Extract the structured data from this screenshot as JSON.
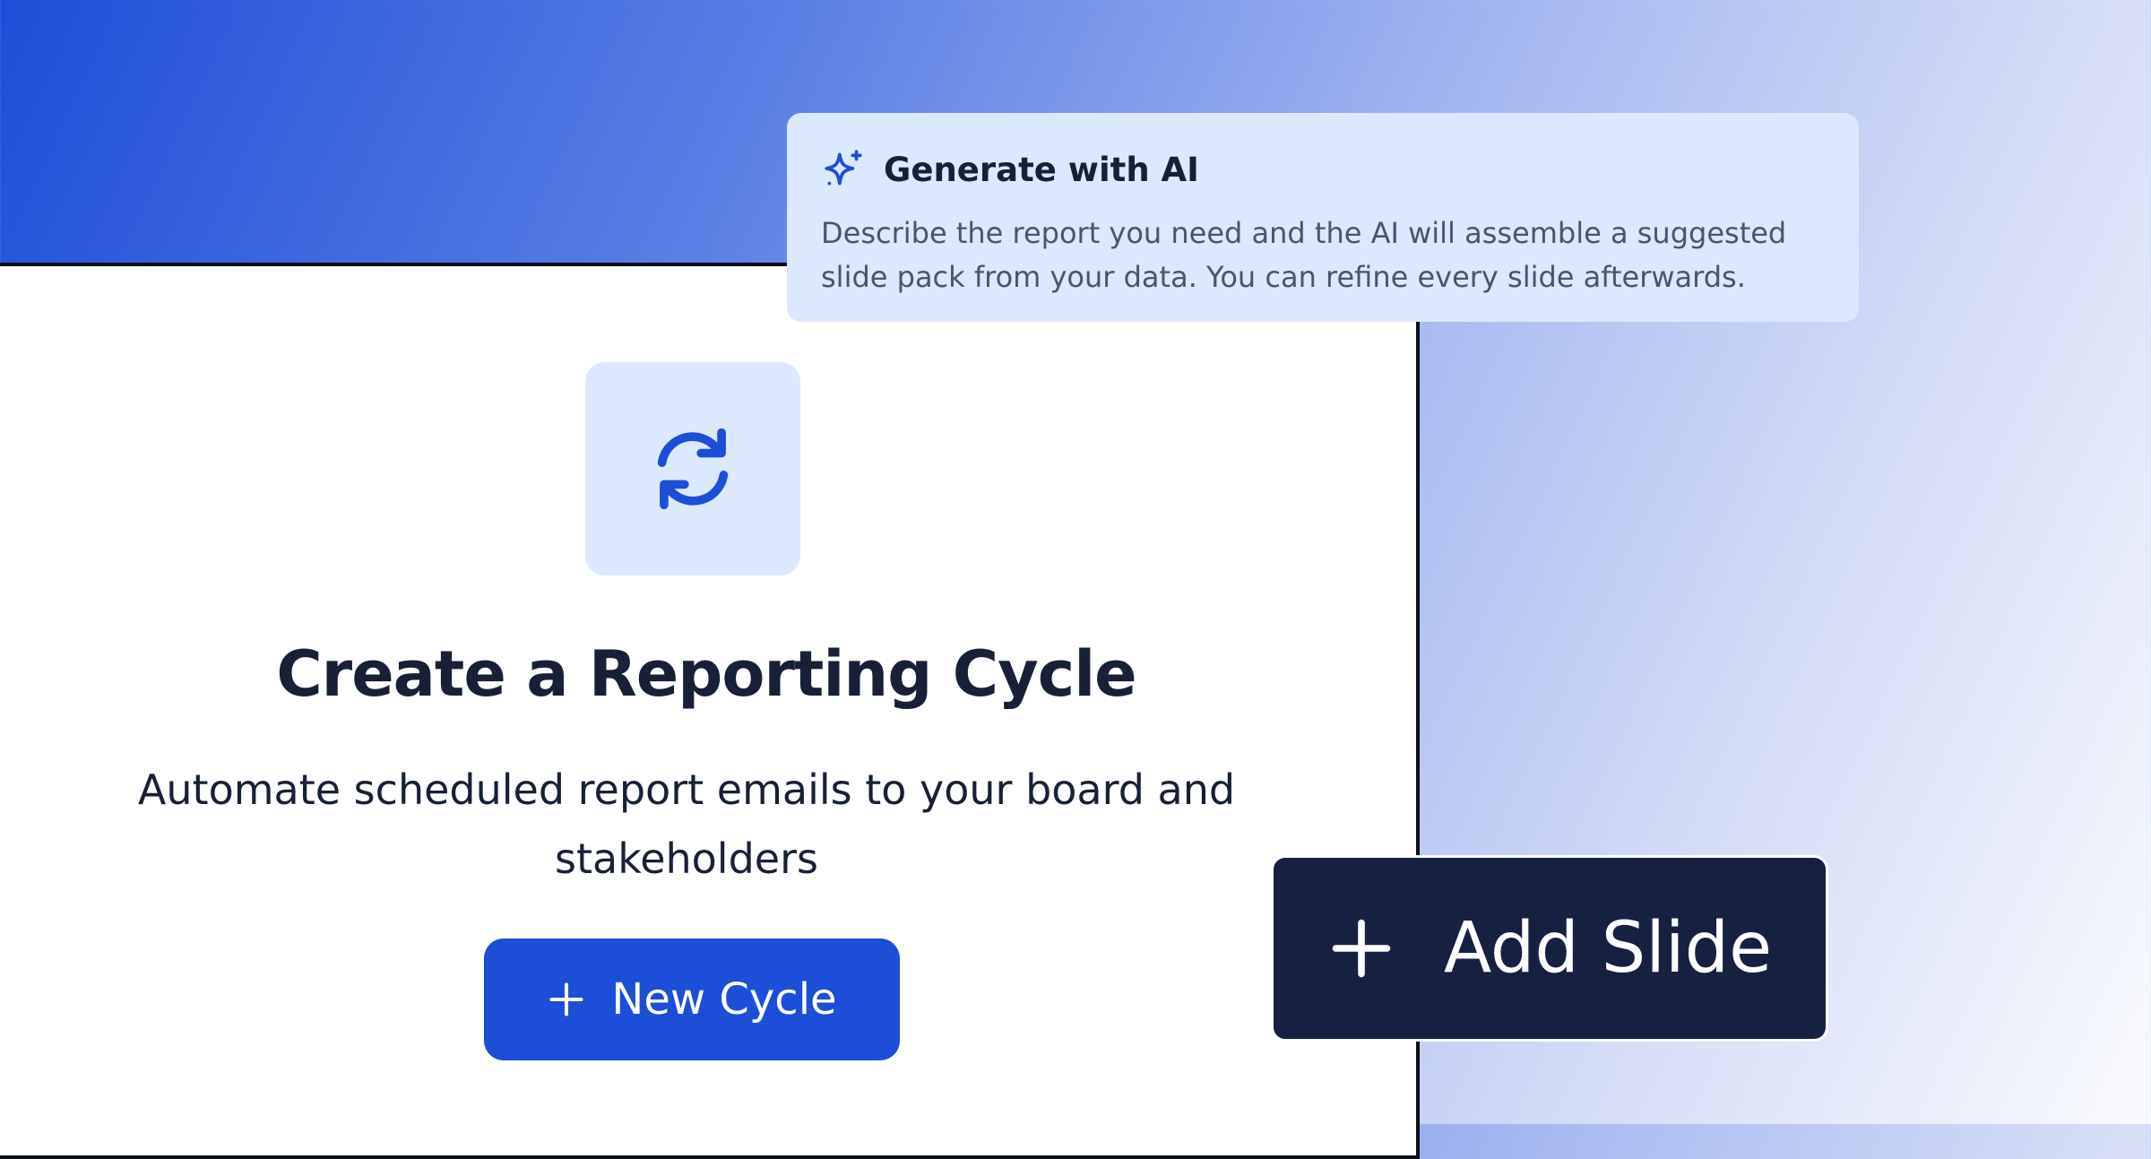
{
  "empty_state": {
    "title": "Create a Reporting Cycle",
    "description": "Automate scheduled report emails to your board and stakeholders",
    "new_cycle_label": "New Cycle"
  },
  "ai_tooltip": {
    "title": "Generate with AI",
    "description": "Describe the report you need and the AI will assemble a suggested slide pack from your data. You can refine every slide afterwards."
  },
  "add_slide": {
    "label": "Add Slide"
  },
  "icons": {
    "cycle": "refresh-icon",
    "ai": "sparkles-icon",
    "plus": "plus-icon"
  },
  "colors": {
    "accent": "#1d4ed8",
    "accent_soft": "#dbe8fe",
    "text_dark": "#172036",
    "button_dark": "#162040"
  }
}
